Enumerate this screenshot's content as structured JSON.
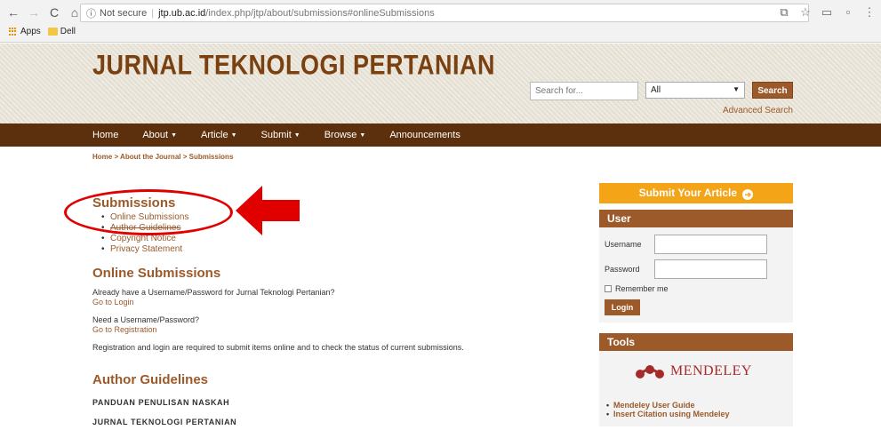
{
  "browser": {
    "secure_label": "Not secure",
    "url_host": "jtp.ub.ac.id",
    "url_path": "/index.php/jtp/about/submissions#onlineSubmissions",
    "bookmarks": [
      "Apps",
      "Dell"
    ]
  },
  "header": {
    "title": "JURNAL TEKNOLOGI PERTANIAN",
    "search_placeholder": "Search for...",
    "search_scope": "All",
    "search_button": "Search",
    "advanced_search": "Advanced Search"
  },
  "nav": {
    "items": [
      "Home",
      "About",
      "Article",
      "Submit",
      "Browse",
      "Announcements"
    ]
  },
  "breadcrumb": "Home > About the Journal > Submissions",
  "main": {
    "heading": "Submissions",
    "toc": [
      "Online Submissions",
      "Author Guidelines",
      "Copyright Notice",
      "Privacy Statement"
    ],
    "online_heading": "Online Submissions",
    "para1": "Already have a Username/Password for Jurnal Teknologi Pertanian?",
    "link_login": "Go to Login",
    "para2": "Need a Username/Password?",
    "link_register": "Go to Registration",
    "para3": "Registration and login are required to submit items online and to check the status of current submissions.",
    "author_heading": "Author Guidelines",
    "guideline_line1": "PANDUAN PENULISAN NASKAH",
    "guideline_line2": "JURNAL TEKNOLOGI PERTANIAN"
  },
  "sidebar": {
    "submit_article": "Submit Your Article",
    "user_heading": "User",
    "username_label": "Username",
    "password_label": "Password",
    "remember_label": "Remember me",
    "login_button": "Login",
    "tools_heading": "Tools",
    "mendeley_text": "MENDELEY",
    "tool_links": [
      "Mendeley User Guide",
      "Insert Citation using Mendeley"
    ]
  },
  "colors": {
    "brand_brown": "#9c5a2a",
    "nav_dark": "#5c300c",
    "accent_orange": "#f3a417",
    "annotation_red": "#e00000"
  }
}
